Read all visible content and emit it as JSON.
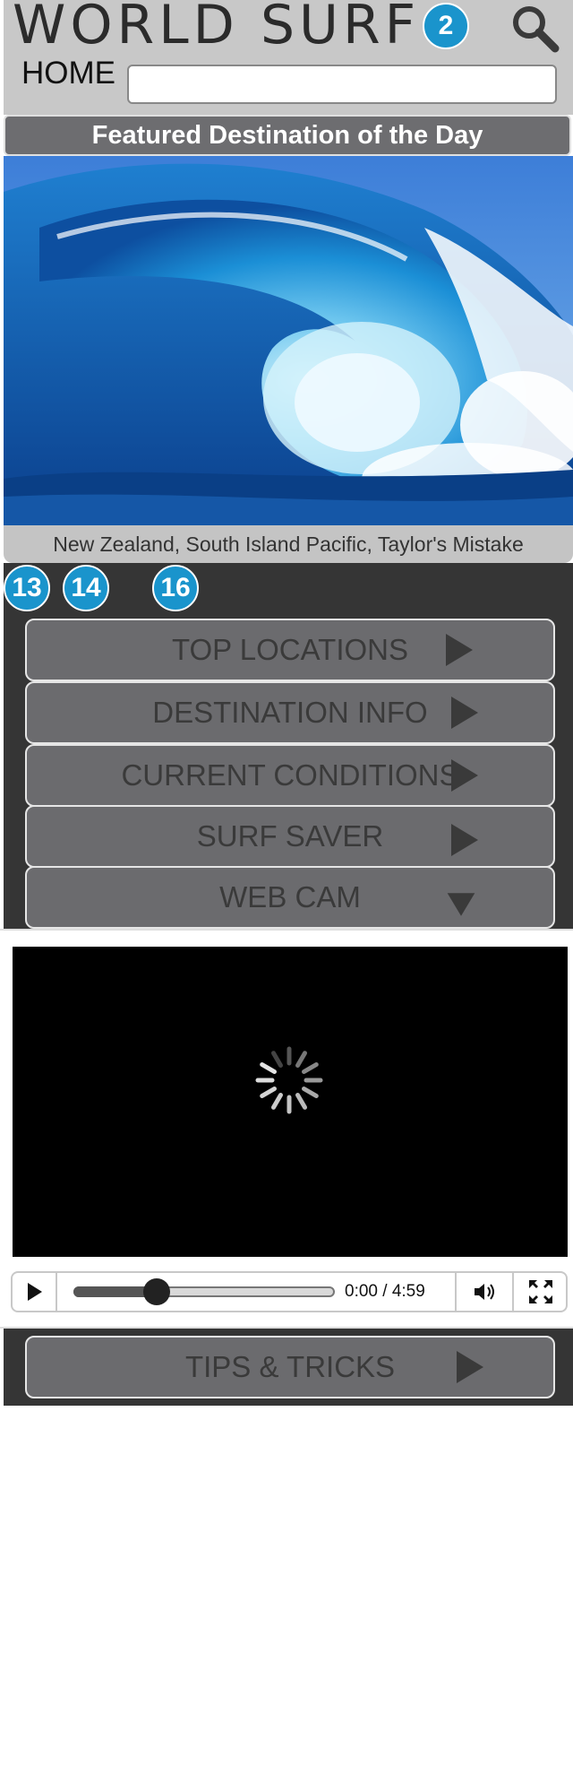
{
  "header": {
    "title": "WORLD SURF",
    "badge_2": "2",
    "home_label": "HOME",
    "search_value": ""
  },
  "featured": {
    "banner": "Featured Destination of the Day",
    "caption": "New Zealand, South Island Pacific, Taylor's Mistake"
  },
  "annotations": {
    "badge_13": "13",
    "badge_14": "14",
    "badge_16": "16"
  },
  "menu": [
    {
      "label": "TOP LOCATIONS",
      "arrow": "right"
    },
    {
      "label": "DESTINATION INFO",
      "arrow": "right"
    },
    {
      "label": "CURRENT CONDITIONS",
      "arrow": "right"
    },
    {
      "label": "SURF SAVER",
      "arrow": "right"
    },
    {
      "label": "WEB CAM",
      "arrow": "down"
    },
    {
      "label": "TIPS & TRICKS",
      "arrow": "right"
    }
  ],
  "video": {
    "time": "0:00 / 4:59",
    "progress_fraction": 0.32
  },
  "colors": {
    "badge": "#1a94cc",
    "panel": "#353535",
    "button": "#6b6b6e"
  }
}
